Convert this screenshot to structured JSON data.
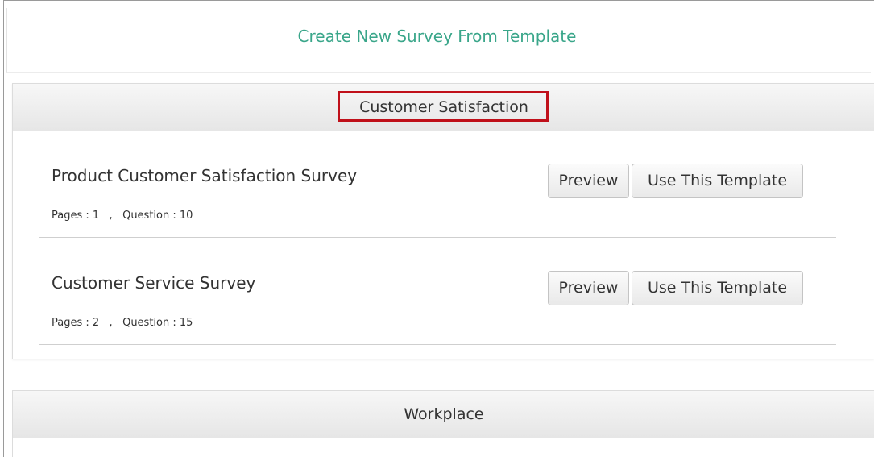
{
  "page": {
    "title": "Create New Survey From Template"
  },
  "categories": [
    {
      "name": "Customer Satisfaction",
      "templates": [
        {
          "name": "Product Customer Satisfaction Survey",
          "meta": "Pages : 1   ,   Question : 10",
          "preview_label": "Preview",
          "use_label": "Use This Template"
        },
        {
          "name": "Customer Service Survey",
          "meta": "Pages : 2   ,   Question : 15",
          "preview_label": "Preview",
          "use_label": "Use This Template"
        }
      ]
    },
    {
      "name": "Workplace"
    }
  ],
  "colors": {
    "title": "#3aa68a",
    "highlight": "#c0101a"
  }
}
